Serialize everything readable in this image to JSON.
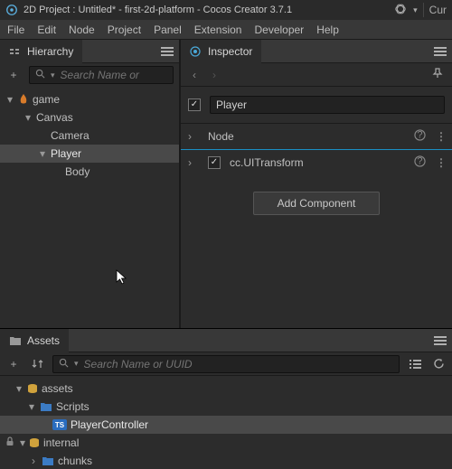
{
  "titlebar": {
    "text": "2D Project : Untitled* - first-2d-platform - Cocos Creator 3.7.1",
    "right_label": "Cur"
  },
  "menubar": [
    "File",
    "Edit",
    "Node",
    "Project",
    "Panel",
    "Extension",
    "Developer",
    "Help"
  ],
  "hierarchy": {
    "tab_label": "Hierarchy",
    "search_placeholder": "Search Name or",
    "tree": {
      "root": {
        "label": "game"
      },
      "canvas": {
        "label": "Canvas"
      },
      "camera": {
        "label": "Camera"
      },
      "player": {
        "label": "Player"
      },
      "body": {
        "label": "Body"
      }
    }
  },
  "inspector": {
    "tab_label": "Inspector",
    "entity_name": "Player",
    "components": {
      "node": {
        "label": "Node"
      },
      "uitransform": {
        "label": "cc.UITransform"
      }
    },
    "add_component_label": "Add Component"
  },
  "assets": {
    "tab_label": "Assets",
    "search_placeholder": "Search Name or UUID",
    "tree": {
      "assets": {
        "label": "assets"
      },
      "scripts": {
        "label": "Scripts"
      },
      "playercontroller": {
        "label": "PlayerController"
      },
      "internal": {
        "label": "internal"
      },
      "chunks": {
        "label": "chunks"
      }
    }
  }
}
